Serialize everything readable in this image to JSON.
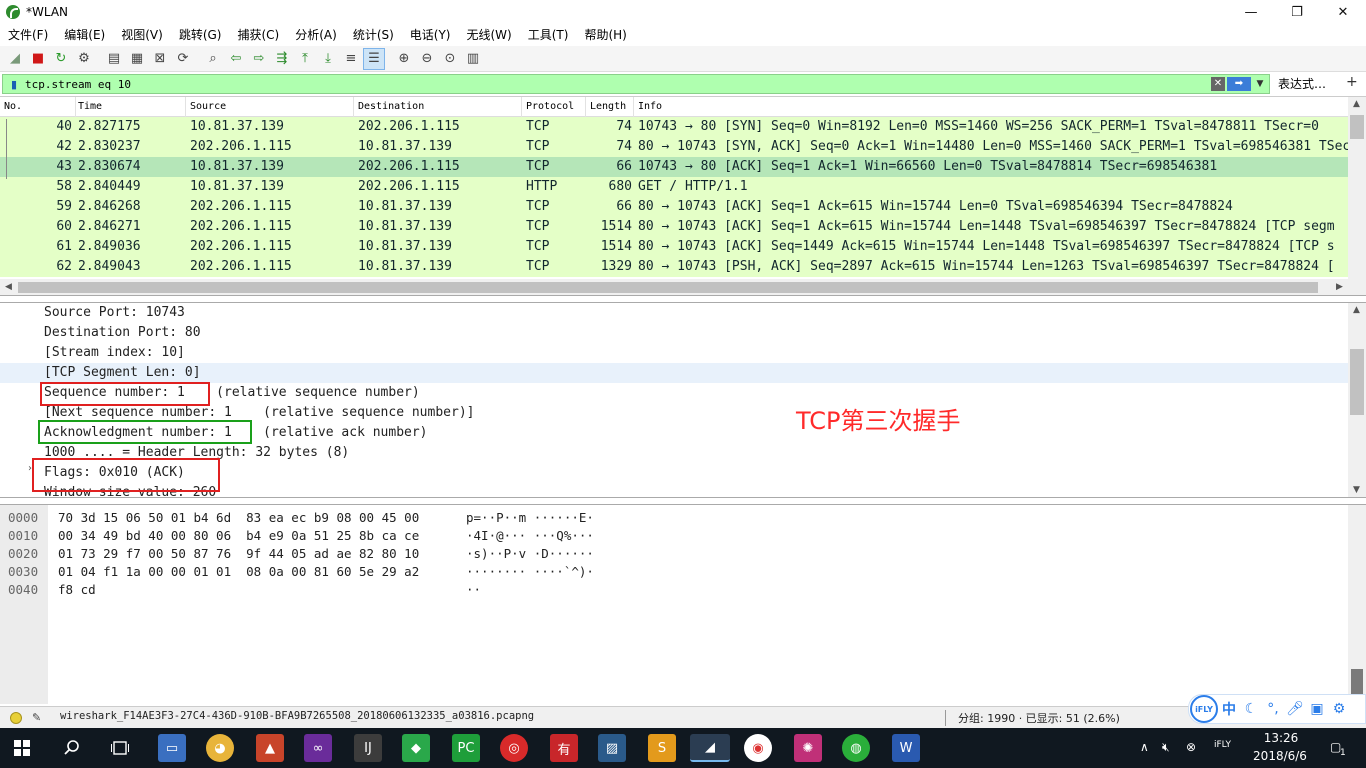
{
  "window": {
    "title": "*WLAN",
    "minimize": "—",
    "maximize": "❐",
    "close": "✕"
  },
  "menu": [
    "文件(F)",
    "编辑(E)",
    "视图(V)",
    "跳转(G)",
    "捕获(C)",
    "分析(A)",
    "统计(S)",
    "电话(Y)",
    "无线(W)",
    "工具(T)",
    "帮助(H)"
  ],
  "toolbar": {
    "icons": [
      "shark-fin-start-icon",
      "stop-capture-icon",
      "restart-capture-icon",
      "capture-options-icon",
      "separator",
      "open-file-icon",
      "save-file-icon",
      "close-file-icon",
      "reload-file-icon",
      "separator",
      "find-packet-icon",
      "go-back-icon",
      "go-forward-icon",
      "go-to-packet-icon",
      "go-first-icon",
      "go-last-icon",
      "auto-scroll-icon",
      "colorize-icon",
      "separator",
      "zoom-in-icon",
      "zoom-out-icon",
      "zoom-normal-icon",
      "resize-columns-icon"
    ]
  },
  "filter": {
    "value": "tcp.stream eq 10",
    "expression_label": "表达式…",
    "plus": "+"
  },
  "packet_list": {
    "columns": [
      "No.",
      "Time",
      "Source",
      "Destination",
      "Protocol",
      "Length",
      "Info"
    ],
    "rows": [
      {
        "no": "40",
        "time": "2.827175",
        "source": "10.81.37.139",
        "destination": "202.206.1.115",
        "protocol": "TCP",
        "length": "74",
        "info": "10743 → 80 [SYN] Seq=0 Win=8192 Len=0 MSS=1460 WS=256 SACK_PERM=1 TSval=8478811 TSecr=0",
        "selected": false
      },
      {
        "no": "42",
        "time": "2.830237",
        "source": "202.206.1.115",
        "destination": "10.81.37.139",
        "protocol": "TCP",
        "length": "74",
        "info": "80 → 10743 [SYN, ACK] Seq=0 Ack=1 Win=14480 Len=0 MSS=1460 SACK_PERM=1 TSval=698546381 TSecr",
        "selected": false
      },
      {
        "no": "43",
        "time": "2.830674",
        "source": "10.81.37.139",
        "destination": "202.206.1.115",
        "protocol": "TCP",
        "length": "66",
        "info": "10743 → 80 [ACK] Seq=1 Ack=1 Win=66560 Len=0 TSval=8478814 TSecr=698546381",
        "selected": true
      },
      {
        "no": "58",
        "time": "2.840449",
        "source": "10.81.37.139",
        "destination": "202.206.1.115",
        "protocol": "HTTP",
        "length": "680",
        "info": "GET / HTTP/1.1",
        "selected": false
      },
      {
        "no": "59",
        "time": "2.846268",
        "source": "202.206.1.115",
        "destination": "10.81.37.139",
        "protocol": "TCP",
        "length": "66",
        "info": "80 → 10743 [ACK] Seq=1 Ack=615 Win=15744 Len=0 TSval=698546394 TSecr=8478824",
        "selected": false
      },
      {
        "no": "60",
        "time": "2.846271",
        "source": "202.206.1.115",
        "destination": "10.81.37.139",
        "protocol": "TCP",
        "length": "1514",
        "info": "80 → 10743 [ACK] Seq=1 Ack=615 Win=15744 Len=1448 TSval=698546397 TSecr=8478824 [TCP segm",
        "selected": false
      },
      {
        "no": "61",
        "time": "2.849036",
        "source": "202.206.1.115",
        "destination": "10.81.37.139",
        "protocol": "TCP",
        "length": "1514",
        "info": "80 → 10743 [ACK] Seq=1449 Ack=615 Win=15744 Len=1448 TSval=698546397 TSecr=8478824 [TCP s",
        "selected": false
      },
      {
        "no": "62",
        "time": "2.849043",
        "source": "202.206.1.115",
        "destination": "10.81.37.139",
        "protocol": "TCP",
        "length": "1329",
        "info": "80 → 10743 [PSH, ACK] Seq=2897 Ack=615 Win=15744 Len=1263 TSval=698546397 TSecr=8478824 [",
        "selected": false
      }
    ]
  },
  "details": {
    "lines": [
      "Source Port: 10743",
      "Destination Port: 80",
      "[Stream index: 10]",
      "[TCP Segment Len: 0]",
      "Sequence number: 1    (relative sequence number)",
      "[Next sequence number: 1    (relative sequence number)]",
      "Acknowledgment number: 1    (relative ack number)",
      "1000 .... = Header Length: 32 bytes (8)",
      "Flags: 0x010 (ACK)",
      "Window size value: 260"
    ],
    "annotation": "TCP第三次握手"
  },
  "bytes": {
    "offsets": [
      "0000",
      "0010",
      "0020",
      "0030",
      "0040"
    ],
    "hex": [
      "70 3d 15 06 50 01 b4 6d  83 ea ec b9 08 00 45 00",
      "00 34 49 bd 40 00 80 06  b4 e9 0a 51 25 8b ca ce",
      "01 73 29 f7 00 50 87 76  9f 44 05 ad ae 82 80 10",
      "01 04 f1 1a 00 00 01 01  08 0a 00 81 60 5e 29 a2",
      "f8 cd"
    ],
    "ascii": [
      "p=··P··m ······E·",
      "·4I·@··· ···Q%···",
      "·s)··P·v ·D······",
      "········ ····`^)·",
      "··"
    ]
  },
  "status": {
    "file": "wireshark_F14AE3F3-27C4-436D-910B-BFA9B7265508_20180606132335_a03816.pcapng",
    "counts": "分组: 1990 · 已显示: 51 (2.6%)"
  },
  "ime": {
    "logo": "iFLY",
    "mode": "中"
  },
  "taskbar": {
    "time": "13:26",
    "date": "2018/6/6",
    "notifications": "1"
  }
}
